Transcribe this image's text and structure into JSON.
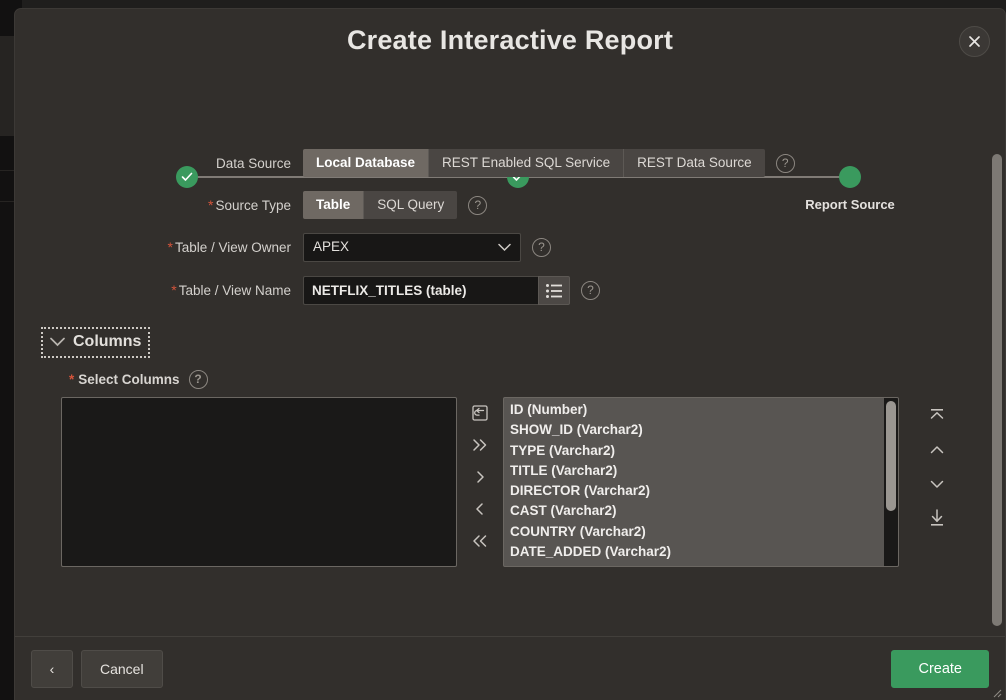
{
  "dialog": {
    "title": "Create Interactive Report",
    "close_label": "×"
  },
  "wizard": {
    "steps": [
      {
        "label": "",
        "state": "complete"
      },
      {
        "label": "",
        "state": "complete"
      },
      {
        "label": "Report Source",
        "state": "current"
      }
    ],
    "current_label": "Report Source"
  },
  "form": {
    "data_source": {
      "label": "Data Source",
      "required": false,
      "options": [
        "Local Database",
        "REST Enabled SQL Service",
        "REST Data Source"
      ],
      "selected": "Local Database",
      "help": "?"
    },
    "source_type": {
      "label": "Source Type",
      "required": true,
      "options": [
        "Table",
        "SQL Query"
      ],
      "selected": "Table",
      "help": "?"
    },
    "table_view_owner": {
      "label": "Table / View Owner",
      "required": true,
      "value": "APEX",
      "help": "?"
    },
    "table_view_name": {
      "label": "Table / View Name",
      "required": true,
      "value": "NETFLIX_TITLES (table)",
      "placeholder": "",
      "help": "?"
    }
  },
  "columns_region": {
    "title": "Columns",
    "collapsed": false,
    "select_columns": {
      "label": "Select Columns",
      "required": true,
      "help": "?",
      "selected_items": [],
      "available_items": [
        "ID (Number)",
        "SHOW_ID (Varchar2)",
        "TYPE (Varchar2)",
        "TITLE (Varchar2)",
        "DIRECTOR (Varchar2)",
        "CAST (Varchar2)",
        "COUNTRY (Varchar2)",
        "DATE_ADDED (Varchar2)"
      ],
      "shuttle_controls": [
        {
          "name": "reset",
          "glyph": "⎌"
        },
        {
          "name": "move-all-right",
          "glyph": "»"
        },
        {
          "name": "move-right",
          "glyph": "›"
        },
        {
          "name": "move-left",
          "glyph": "‹"
        },
        {
          "name": "move-all-left",
          "glyph": "«"
        }
      ],
      "order_controls": [
        {
          "name": "move-to-top",
          "glyph": "⤒"
        },
        {
          "name": "move-up",
          "glyph": "⌃"
        },
        {
          "name": "move-down",
          "glyph": "⌄"
        },
        {
          "name": "move-to-bottom",
          "glyph": "⤓"
        }
      ]
    }
  },
  "footer": {
    "back_label": "‹",
    "cancel_label": "Cancel",
    "create_label": "Create"
  },
  "colors": {
    "dialog_bg": "#322f2c",
    "accent_green": "#3a9a5e",
    "required_red": "#d5543b",
    "selected_option_bg": "#6f6963"
  }
}
